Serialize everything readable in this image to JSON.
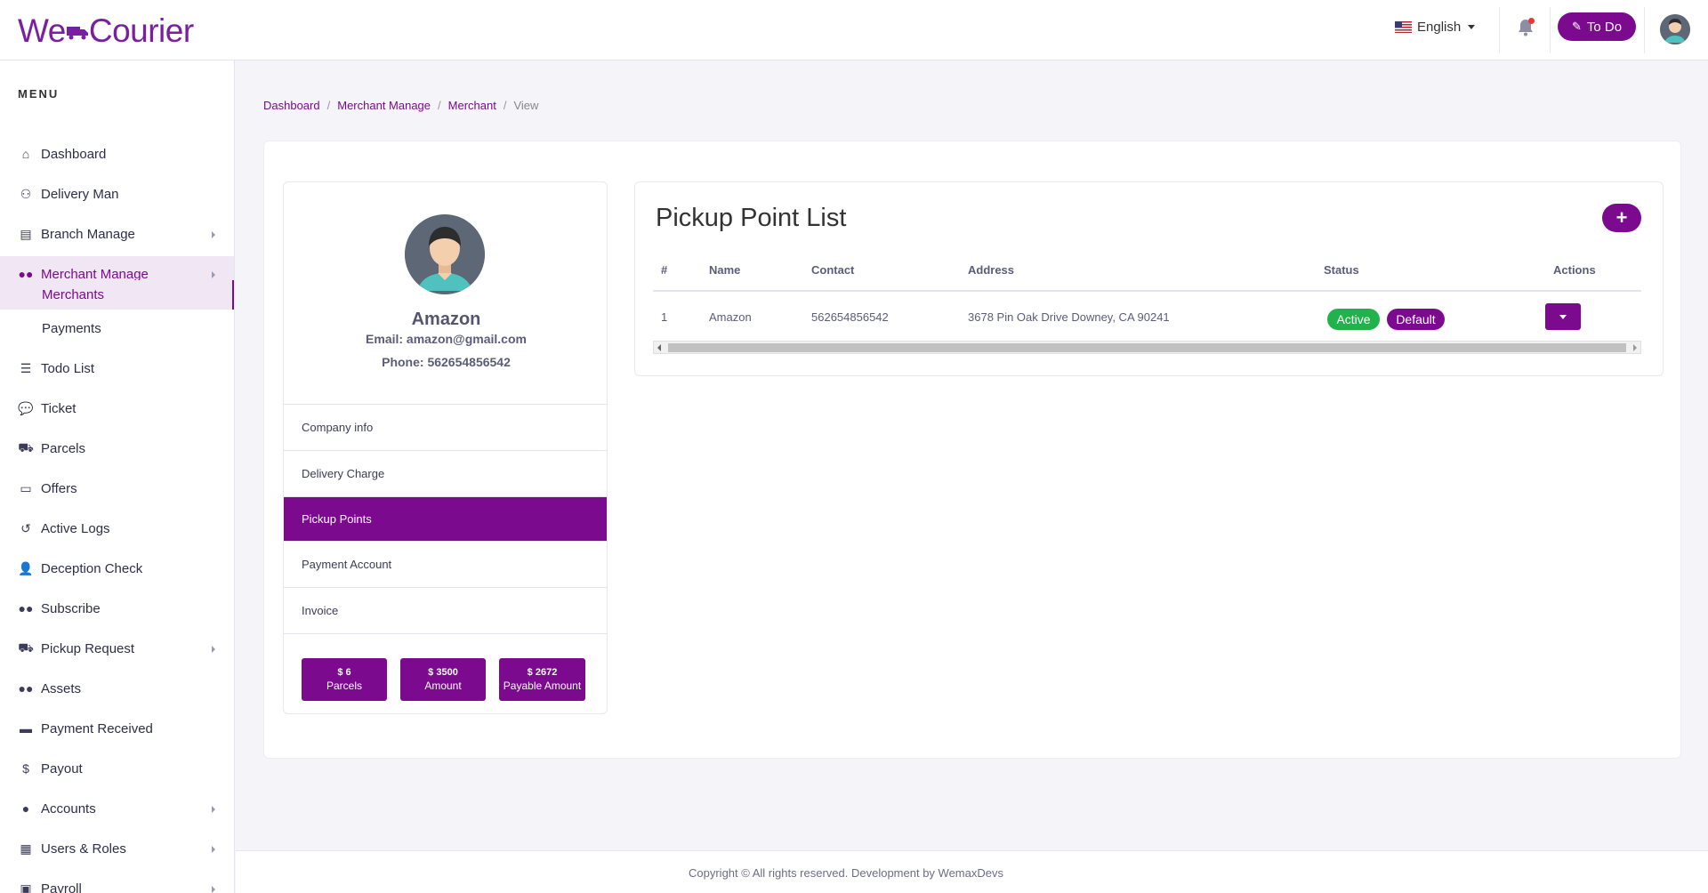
{
  "header": {
    "logo_prefix": "We",
    "logo_suffix": "Courier",
    "language": "English",
    "todo_label": "To Do"
  },
  "sidebar": {
    "menu_title": "MENU",
    "items": [
      {
        "label": "Dashboard",
        "icon": "home-icon"
      },
      {
        "label": "Delivery Man",
        "icon": "people-carry-icon"
      },
      {
        "label": "Branch Manage",
        "icon": "warehouse-icon"
      },
      {
        "label": "Merchant Manage",
        "icon": "users-icon"
      },
      {
        "label": "Todo List",
        "icon": "list-check-icon"
      },
      {
        "label": "Ticket",
        "icon": "comments-icon"
      },
      {
        "label": "Parcels",
        "icon": "dolly-icon"
      },
      {
        "label": "Offers",
        "icon": "offer-icon"
      },
      {
        "label": "Active Logs",
        "icon": "history-icon"
      },
      {
        "label": "Deception Check",
        "icon": "user-times-icon"
      },
      {
        "label": "Subscribe",
        "icon": "users-icon"
      },
      {
        "label": "Pickup Request",
        "icon": "truck-icon"
      },
      {
        "label": "Assets",
        "icon": "users-icon"
      },
      {
        "label": "Payment Received",
        "icon": "credit-card-icon"
      },
      {
        "label": "Payout",
        "icon": "hand-money-icon"
      },
      {
        "label": "Accounts",
        "icon": "user-icon"
      },
      {
        "label": "Users & Roles",
        "icon": "grid-icon"
      },
      {
        "label": "Payroll",
        "icon": "payroll-icon"
      }
    ],
    "sub_items": [
      "Merchants",
      "Payments"
    ]
  },
  "breadcrumb": {
    "items": [
      "Dashboard",
      "Merchant Manage",
      "Merchant"
    ],
    "current": "View",
    "separator": "/"
  },
  "profile": {
    "name": "Amazon",
    "email": "Email: amazon@gmail.com",
    "phone": "Phone: 562654856542",
    "menu": [
      "Company info",
      "Delivery Charge",
      "Pickup Points",
      "Payment Account",
      "Invoice"
    ],
    "active_menu": "Pickup Points",
    "stats": [
      {
        "value": "$ 6",
        "label": "Parcels"
      },
      {
        "value": "$ 3500",
        "label": "Amount"
      },
      {
        "value": "$ 2672",
        "label": "Payable Amount"
      }
    ]
  },
  "pickup": {
    "title": "Pickup Point List",
    "add_symbol": "+",
    "columns": [
      "#",
      "Name",
      "Contact",
      "Address",
      "Status",
      "Actions"
    ],
    "rows": [
      {
        "num": "1",
        "name": "Amazon",
        "contact": "562654856542",
        "address": "3678 Pin Oak Drive Downey, CA 90241",
        "status": "Active",
        "tag": "Default"
      }
    ]
  },
  "footer": {
    "text": "Copyright © All rights reserved. Development by WemaxDevs"
  },
  "colors": {
    "brand": "#7b0a8f",
    "active_badge": "#22b24c",
    "background": "#f4f4f9"
  }
}
